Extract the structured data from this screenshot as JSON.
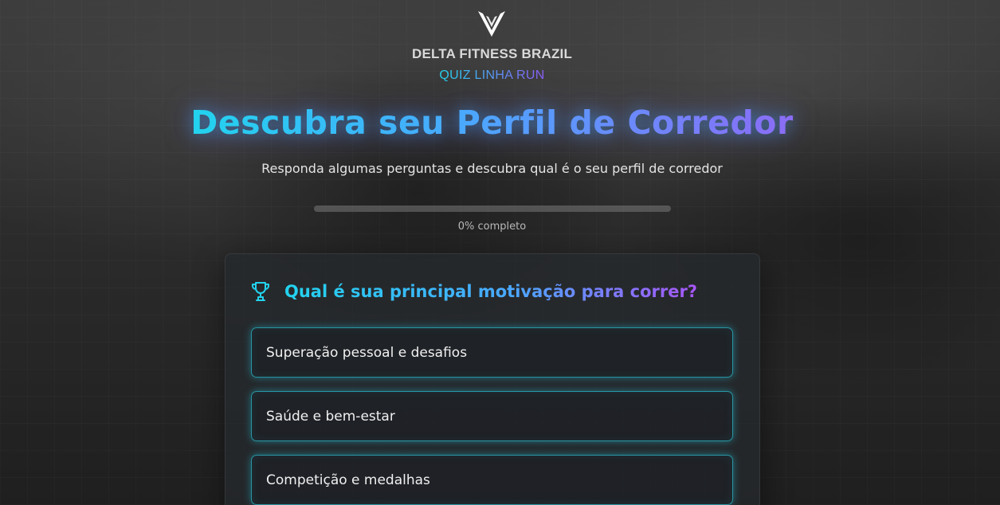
{
  "header": {
    "logo_icon": "delta-v-logo-icon",
    "brand": "DELTA FITNESS BRAZIL",
    "quiz_name": "QUIZ LINHA RUN"
  },
  "hero": {
    "title": "Descubra seu Perfil de Corredor",
    "subtitle": "Responda algumas perguntas e descubra qual é o seu perfil de corredor"
  },
  "progress": {
    "percent": 0,
    "label": "0% completo"
  },
  "quiz": {
    "question_icon": "trophy-icon",
    "question": "Qual é sua principal motivação para correr?",
    "options": [
      {
        "label": "Superação pessoal e desafios"
      },
      {
        "label": "Saúde e bem-estar"
      },
      {
        "label": "Competição e medalhas"
      }
    ]
  },
  "colors": {
    "accent_cyan": "#22d3ee",
    "accent_purple": "#8b5cf6",
    "background": "#2a2a2a"
  }
}
